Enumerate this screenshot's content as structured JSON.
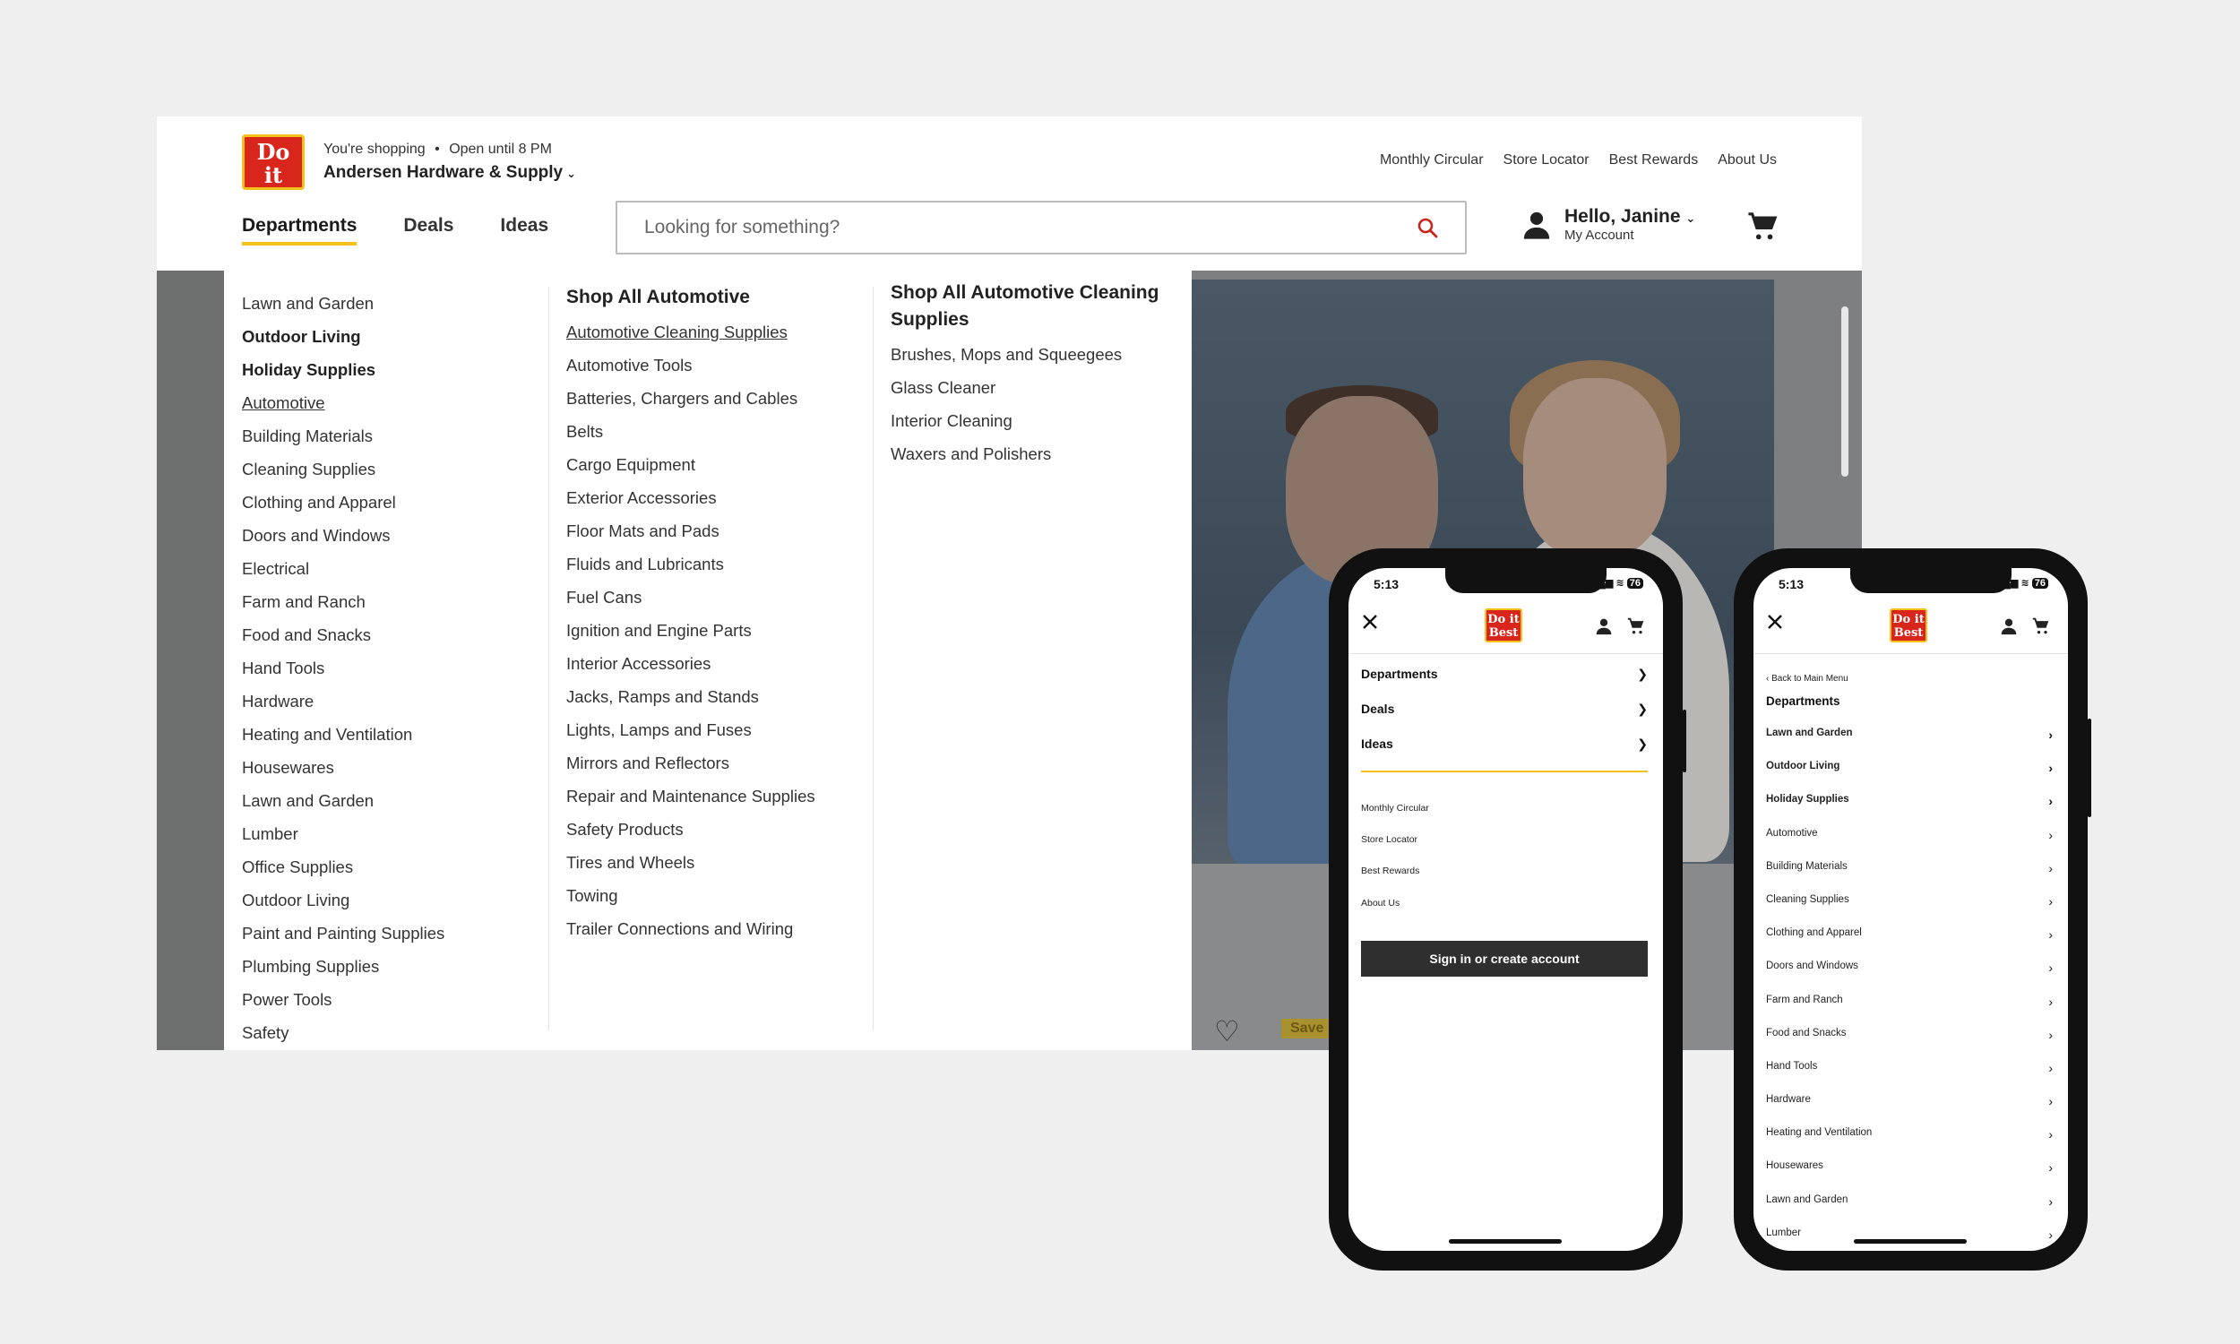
{
  "brand": {
    "logo_line1": "Do it",
    "logo_line2": "Best"
  },
  "store": {
    "shopping_label": "You're shopping",
    "separator": "•",
    "hours": "Open until 8 PM",
    "name": "Andersen Hardware & Supply"
  },
  "top_links": [
    "Monthly Circular",
    "Store Locator",
    "Best Rewards",
    "About Us"
  ],
  "main_nav": [
    "Departments",
    "Deals",
    "Ideas"
  ],
  "search": {
    "placeholder": "Looking for something?"
  },
  "account": {
    "greeting": "Hello, Janine",
    "sub": "My Account"
  },
  "departments": [
    "Lawn and Garden",
    "Outdoor Living",
    "Holiday Supplies",
    "Automotive",
    "Building Materials",
    "Cleaning Supplies",
    "Clothing and Apparel",
    "Doors and Windows",
    "Electrical",
    "Farm and Ranch",
    "Food and Snacks",
    "Hand Tools",
    "Hardware",
    "Heating and Ventilation",
    "Housewares",
    "Lawn and Garden",
    "Lumber",
    "Office Supplies",
    "Outdoor Living",
    "Paint and Painting Supplies",
    "Plumbing Supplies",
    "Power Tools",
    "Safety"
  ],
  "automotive": {
    "heading": "Shop All Automotive",
    "items": [
      "Automotive Cleaning Supplies",
      "Automotive Tools",
      "Batteries, Chargers and Cables",
      "Belts",
      "Cargo Equipment",
      "Exterior Accessories",
      "Floor Mats and Pads",
      "Fluids and Lubricants",
      "Fuel Cans",
      "Ignition and Engine Parts",
      "Interior Accessories",
      "Jacks, Ramps and Stands",
      "Lights, Lamps and Fuses",
      "Mirrors and Reflectors",
      "Repair and Maintenance Supplies",
      "Safety Products",
      "Tires and Wheels",
      "Towing",
      "Trailer Connections and Wiring"
    ]
  },
  "cleaning": {
    "heading": "Shop All Automotive Cleaning Supplies",
    "items": [
      "Brushes, Mops and Squeegees",
      "Glass Cleaner",
      "Interior Cleaning",
      "Waxers and Polishers"
    ]
  },
  "promo": {
    "save_label": "Save"
  },
  "phone1": {
    "time": "5:13",
    "battery": "76",
    "nav": [
      "Departments",
      "Deals",
      "Ideas"
    ],
    "links": [
      "Monthly Circular",
      "Store Locator",
      "Best Rewards",
      "About Us"
    ],
    "signin": "Sign in or create account"
  },
  "phone2": {
    "time": "5:13",
    "battery": "76",
    "back": "Back to Main Menu",
    "title": "Departments",
    "items": [
      "Lawn and Garden",
      "Outdoor Living",
      "Holiday Supplies",
      "Automotive",
      "Building Materials",
      "Cleaning Supplies",
      "Clothing and Apparel",
      "Doors and Windows",
      "Farm and Ranch",
      "Food and Snacks",
      "Hand Tools",
      "Hardware",
      "Heating and Ventilation",
      "Housewares",
      "Lawn and Garden",
      "Lumber"
    ]
  }
}
